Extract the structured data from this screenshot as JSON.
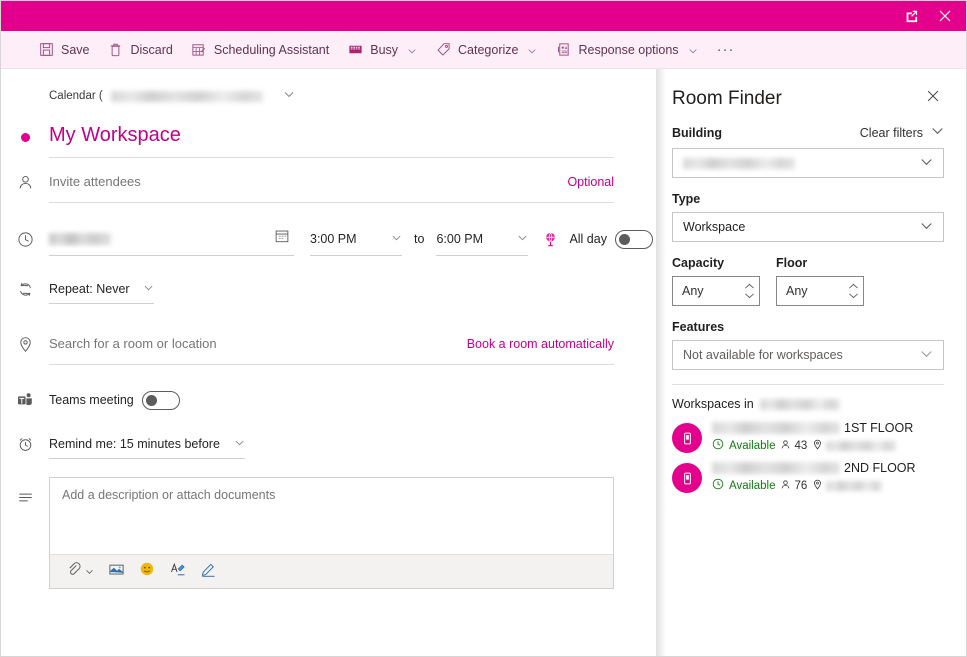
{
  "titlebar": {
    "popout_icon": "popout-icon",
    "close_icon": "close-icon",
    "background": "#e3008c"
  },
  "toolbar": {
    "items": [
      {
        "label": "Save",
        "icon": "save-icon",
        "chevron": false
      },
      {
        "label": "Discard",
        "icon": "trash-icon",
        "chevron": false
      },
      {
        "label": "Scheduling Assistant",
        "icon": "calendar-grid-icon",
        "chevron": false
      },
      {
        "label": "Busy",
        "icon": "busy-status-icon",
        "chevron": true
      },
      {
        "label": "Categorize",
        "icon": "tag-icon",
        "chevron": true
      },
      {
        "label": "Response options",
        "icon": "response-options-icon",
        "chevron": true
      }
    ],
    "overflow": "···"
  },
  "form": {
    "calendar": {
      "label": "Calendar (",
      "value_redacted": true,
      "chevron_icon": "chevron-down-icon"
    },
    "title": {
      "value": "My Workspace",
      "color": "#c2008a",
      "dot_icon": "category-dot-icon"
    },
    "attendees": {
      "icon": "person-icon",
      "placeholder": "Invite attendees",
      "optional_label": "Optional"
    },
    "datetime": {
      "icon": "clock-icon",
      "date_value_redacted": true,
      "calendar_icon": "calendar-icon",
      "start_time": "3:00 PM",
      "to_label": "to",
      "end_time": "6:00 PM",
      "timezone_icon": "globe-icon",
      "all_day_label": "All day",
      "all_day_on": false
    },
    "repeat": {
      "icon": "repeat-icon",
      "label": "Repeat: Never"
    },
    "location": {
      "icon": "location-pin-icon",
      "placeholder": "Search for a room or location",
      "book_link": "Book a room automatically"
    },
    "teams": {
      "icon": "teams-icon",
      "label": "Teams meeting",
      "enabled": false
    },
    "remind": {
      "icon": "alarm-clock-icon",
      "label": "Remind me: 15 minutes before"
    },
    "description": {
      "icon": "text-lines-icon",
      "placeholder": "Add a description or attach documents",
      "toolbar_icons": [
        "attach-icon",
        "insert-picture-icon",
        "emoji-icon",
        "text-effects-icon",
        "signature-pen-icon"
      ]
    }
  },
  "room_finder": {
    "title": "Room Finder",
    "close_icon": "close-icon",
    "building": {
      "label": "Building",
      "clear_filters": "Clear filters",
      "collapse_icon": "chevron-down-icon",
      "value_redacted": true
    },
    "type": {
      "label": "Type",
      "value": "Workspace"
    },
    "capacity": {
      "label": "Capacity",
      "value": "Any"
    },
    "floor": {
      "label": "Floor",
      "value": "Any"
    },
    "features": {
      "label": "Features",
      "value": "Not available for workspaces"
    },
    "workspaces_header": "Workspaces in ",
    "workspaces": [
      {
        "name_redacted": true,
        "name_suffix": "1ST FLOOR",
        "status": "Available",
        "status_icon": "clock-available-icon",
        "capacity_icon": "person-icon",
        "capacity": "43",
        "location_icon": "location-pin-icon",
        "location_redacted": true
      },
      {
        "name_redacted": true,
        "name_suffix": "2ND FLOOR",
        "status": "Available",
        "status_icon": "clock-available-icon",
        "capacity_icon": "person-icon",
        "capacity": "76",
        "location_icon": "location-pin-icon",
        "location_redacted": true
      }
    ],
    "accent_color": "#e3008c",
    "available_color": "#107c10"
  }
}
